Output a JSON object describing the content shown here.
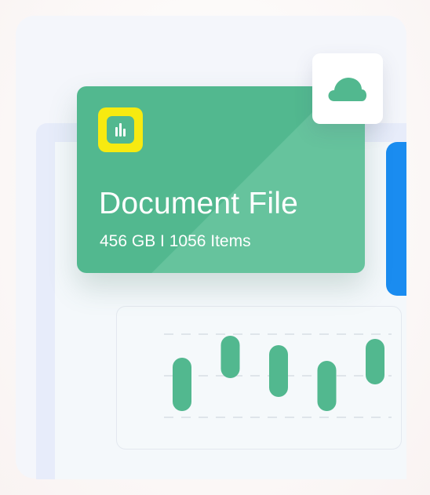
{
  "document_card": {
    "title": "Document File",
    "subtitle": "456 GB I 1056 Items",
    "icon": "bar-chart-icon"
  },
  "cloud_card": {
    "icon": "cloud-icon"
  },
  "colors": {
    "card_green": "#52b88f",
    "icon_yellow": "#f7ea10",
    "accent_blue": "#1a8cf0",
    "bar_green": "#52b88f"
  },
  "chart_data": {
    "type": "bar",
    "series": [
      {
        "values": [
          [
            1.0,
            2.7
          ],
          [
            2.05,
            3.4
          ],
          [
            1.45,
            3.1
          ],
          [
            1.0,
            2.6
          ],
          [
            1.85,
            3.3
          ]
        ]
      }
    ],
    "grid": true
  }
}
